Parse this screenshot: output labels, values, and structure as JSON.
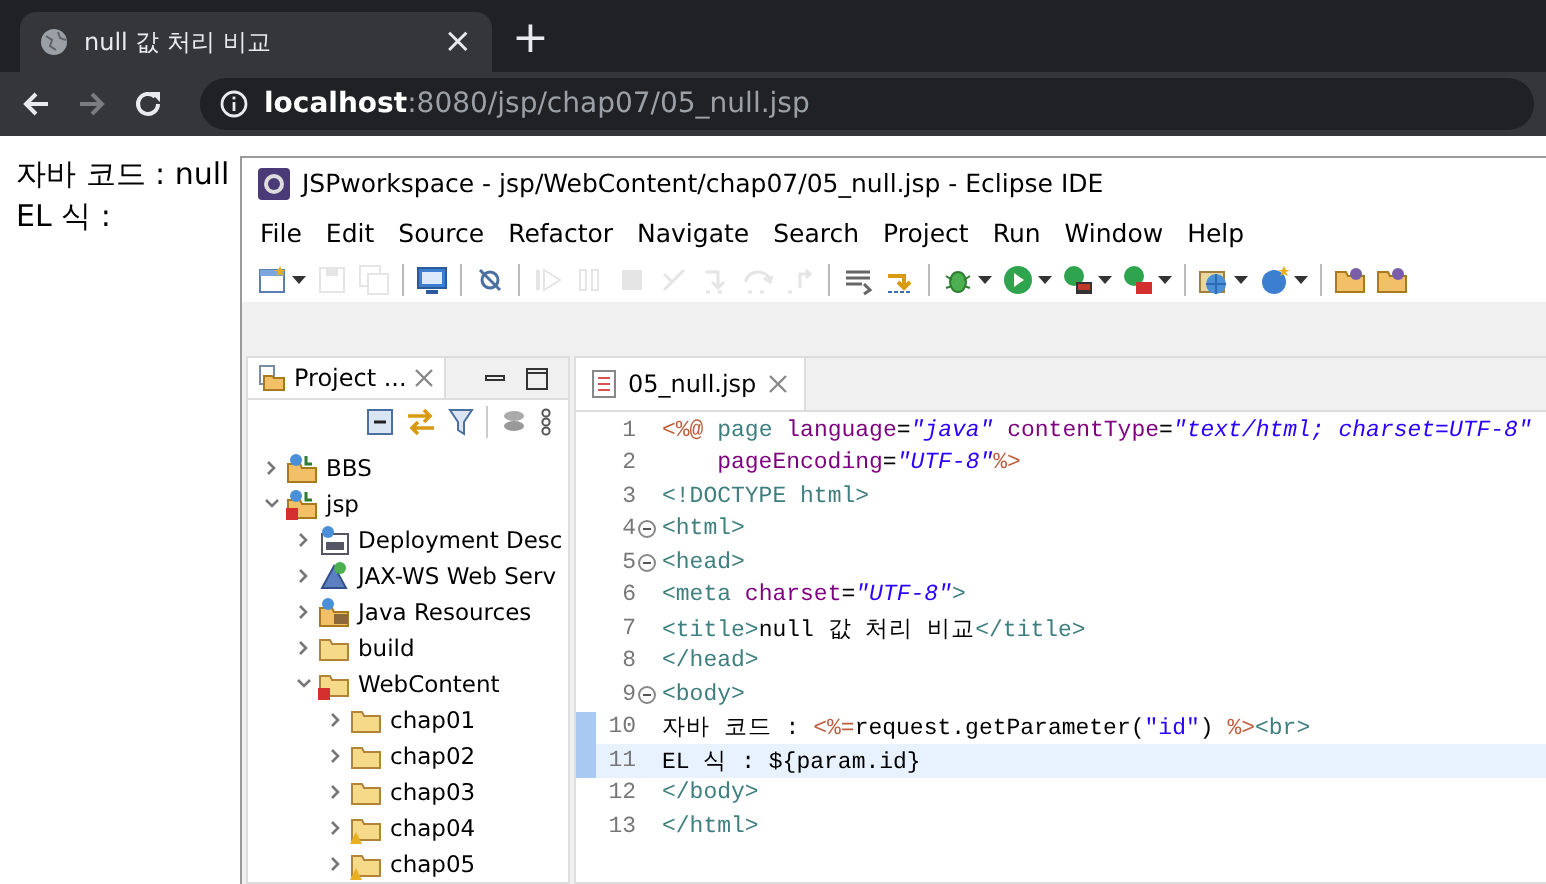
{
  "browser": {
    "tab": {
      "title": "null 값 처리 비교",
      "close": "×"
    },
    "new_tab": "+",
    "nav": [
      {
        "kind": "back",
        "disabled": false
      },
      {
        "kind": "forward",
        "disabled": true
      },
      {
        "kind": "reload",
        "disabled": false
      }
    ],
    "address": {
      "url": "**localhost**:8080/jsp/chap07/05_null.jsp"
    }
  },
  "page": {
    "lines": [
      "자바 코드 : null",
      "EL 식 :"
    ]
  },
  "eclipse": {
    "title": "JSPworkspace - jsp/WebContent/chap07/05_null.jsp - Eclipse IDE",
    "menus": [
      "File",
      "Edit",
      "Source",
      "Refactor",
      "Navigate",
      "Search",
      "Project",
      "Run",
      "Window",
      "Help"
    ],
    "toolbar": [
      {
        "items": [
          {
            "kind": "new",
            "disabled": false,
            "dropdown": true
          },
          {
            "kind": "save",
            "disabled": true,
            "dropdown": false
          },
          {
            "kind": "save-all",
            "disabled": true,
            "dropdown": false
          }
        ]
      },
      {
        "items": [
          {
            "kind": "monitor",
            "disabled": false,
            "dropdown": false
          }
        ]
      },
      {
        "items": [
          {
            "kind": "skip",
            "disabled": false,
            "dropdown": false
          }
        ]
      },
      {
        "items": [
          {
            "kind": "resume",
            "disabled": true,
            "dropdown": false
          },
          {
            "kind": "suspend",
            "disabled": true,
            "dropdown": false
          },
          {
            "kind": "terminate",
            "disabled": true,
            "dropdown": false
          },
          {
            "kind": "disconnect",
            "disabled": true,
            "dropdown": false
          },
          {
            "kind": "step-into",
            "disabled": true,
            "dropdown": false
          },
          {
            "kind": "step-over",
            "disabled": true,
            "dropdown": false
          },
          {
            "kind": "step-return",
            "disabled": true,
            "dropdown": false
          }
        ]
      },
      {
        "items": [
          {
            "kind": "list",
            "disabled": false,
            "dropdown": false
          },
          {
            "kind": "toggle",
            "disabled": false,
            "dropdown": false
          }
        ]
      },
      {
        "items": [
          {
            "kind": "debug",
            "disabled": false,
            "dropdown": true
          },
          {
            "kind": "run",
            "disabled": false,
            "dropdown": true
          },
          {
            "kind": "run-server",
            "disabled": false,
            "dropdown": true
          },
          {
            "kind": "stop-server",
            "disabled": false,
            "dropdown": true
          }
        ]
      },
      {
        "items": [
          {
            "kind": "globe",
            "disabled": false,
            "dropdown": true
          },
          {
            "kind": "new-class",
            "disabled": false,
            "dropdown": true
          }
        ]
      },
      {
        "items": [
          {
            "kind": "folder",
            "disabled": false,
            "dropdown": false
          },
          {
            "kind": "folder",
            "disabled": false,
            "dropdown": false
          }
        ]
      }
    ],
    "explorer": {
      "title": "Project ...",
      "tree": [
        {
          "label": "BBS",
          "kind": "project",
          "error": false,
          "warning": false,
          "expanded": false
        },
        {
          "label": "jsp",
          "kind": "project",
          "error": true,
          "warning": false,
          "expanded": true,
          "children": [
            {
              "label": "Deployment Desc",
              "kind": "descriptor",
              "error": false,
              "warning": false,
              "expanded": false
            },
            {
              "label": "JAX-WS Web Serv",
              "kind": "webservice",
              "error": false,
              "warning": false,
              "expanded": false
            },
            {
              "label": "Java Resources",
              "kind": "javares",
              "error": false,
              "warning": false,
              "expanded": false
            },
            {
              "label": "build",
              "kind": "folder",
              "error": false,
              "warning": false,
              "expanded": false
            },
            {
              "label": "WebContent",
              "kind": "folder",
              "error": true,
              "warning": false,
              "expanded": true,
              "children": [
                {
                  "label": "chap01",
                  "kind": "folder",
                  "error": false,
                  "warning": false,
                  "expanded": false
                },
                {
                  "label": "chap02",
                  "kind": "folder",
                  "error": false,
                  "warning": false,
                  "expanded": false
                },
                {
                  "label": "chap03",
                  "kind": "folder",
                  "error": false,
                  "warning": false,
                  "expanded": false
                },
                {
                  "label": "chap04",
                  "kind": "folder",
                  "error": false,
                  "warning": true,
                  "expanded": false
                },
                {
                  "label": "chap05",
                  "kind": "folder",
                  "error": false,
                  "warning": true,
                  "expanded": false
                }
              ]
            }
          ]
        }
      ]
    },
    "editor": {
      "tab": "05_null.jsp",
      "lines": [
        {
          "number": "1",
          "fold": false,
          "indent": false,
          "changed": false,
          "current": false,
          "segments": [
            {
              "kind": "directive",
              "text": "<%@"
            },
            {
              "kind": "tag",
              "text": " page"
            },
            {
              "kind": "attr",
              "text": " language"
            },
            {
              "kind": "text",
              "text": "="
            },
            {
              "kind": "value",
              "text": "\"java\""
            },
            {
              "kind": "attr",
              "text": " contentType"
            },
            {
              "kind": "text",
              "text": "="
            },
            {
              "kind": "value",
              "text": "\"text/html; charset=UTF-8\""
            }
          ]
        },
        {
          "number": "2",
          "fold": false,
          "indent": true,
          "changed": false,
          "current": false,
          "segments": [
            {
              "kind": "attr",
              "text": "pageEncoding"
            },
            {
              "kind": "text",
              "text": "="
            },
            {
              "kind": "value",
              "text": "\"UTF-8\""
            },
            {
              "kind": "directive",
              "text": "%>"
            }
          ]
        },
        {
          "number": "3",
          "fold": false,
          "indent": false,
          "changed": false,
          "current": false,
          "segments": [
            {
              "kind": "tag",
              "text": "<!DOCTYPE html>"
            }
          ]
        },
        {
          "number": "4",
          "fold": true,
          "indent": false,
          "changed": false,
          "current": false,
          "segments": [
            {
              "kind": "tag",
              "text": "<html>"
            }
          ]
        },
        {
          "number": "5",
          "fold": true,
          "indent": false,
          "changed": false,
          "current": false,
          "segments": [
            {
              "kind": "tag",
              "text": "<head>"
            }
          ]
        },
        {
          "number": "6",
          "fold": false,
          "indent": false,
          "changed": false,
          "current": false,
          "segments": [
            {
              "kind": "tag",
              "text": "<meta"
            },
            {
              "kind": "attr",
              "text": " charset"
            },
            {
              "kind": "text",
              "text": "="
            },
            {
              "kind": "value",
              "text": "\"UTF-8\""
            },
            {
              "kind": "tag",
              "text": ">"
            }
          ]
        },
        {
          "number": "7",
          "fold": false,
          "indent": false,
          "changed": false,
          "current": false,
          "segments": [
            {
              "kind": "tag",
              "text": "<title>"
            },
            {
              "kind": "text",
              "text": "null 값 처리 비교"
            },
            {
              "kind": "tag",
              "text": "</title>"
            }
          ]
        },
        {
          "number": "8",
          "fold": false,
          "indent": false,
          "changed": false,
          "current": false,
          "segments": [
            {
              "kind": "tag",
              "text": "</head>"
            }
          ]
        },
        {
          "number": "9",
          "fold": true,
          "indent": false,
          "changed": false,
          "current": false,
          "segments": [
            {
              "kind": "tag",
              "text": "<body>"
            }
          ]
        },
        {
          "number": "10",
          "fold": false,
          "indent": false,
          "changed": true,
          "current": false,
          "segments": [
            {
              "kind": "text",
              "text": "자바 코드 : "
            },
            {
              "kind": "directive",
              "text": "<%="
            },
            {
              "kind": "text",
              "text": "request.getParameter("
            },
            {
              "kind": "string",
              "text": "\"id\""
            },
            {
              "kind": "text",
              "text": ") "
            },
            {
              "kind": "directive",
              "text": "%>"
            },
            {
              "kind": "tag",
              "text": "<br>"
            }
          ]
        },
        {
          "number": "11",
          "fold": false,
          "indent": false,
          "changed": true,
          "current": true,
          "segments": [
            {
              "kind": "text",
              "text": "EL 식 : ${param.id}"
            }
          ]
        },
        {
          "number": "12",
          "fold": false,
          "indent": false,
          "changed": false,
          "current": false,
          "segments": [
            {
              "kind": "tag",
              "text": "</body>"
            }
          ]
        },
        {
          "number": "13",
          "fold": false,
          "indent": false,
          "changed": false,
          "current": false,
          "segments": [
            {
              "kind": "tag",
              "text": "</html>"
            }
          ]
        }
      ]
    }
  }
}
